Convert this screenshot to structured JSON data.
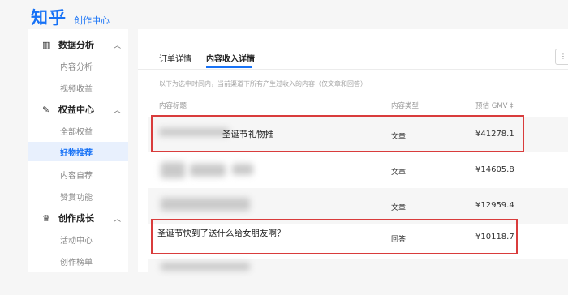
{
  "brand": {
    "logo": "知乎",
    "subtitle": "创作中心"
  },
  "sidebar": {
    "groups": [
      {
        "label": "数据分析",
        "icon": "bar-chart-icon",
        "items": [
          "内容分析",
          "视频收益"
        ]
      },
      {
        "label": "权益中心",
        "icon": "pen-icon",
        "items": [
          "全部权益",
          "好物推荐",
          "内容自荐",
          "赞赏功能"
        ]
      },
      {
        "label": "创作成长",
        "icon": "cup-icon",
        "items": [
          "活动中心",
          "创作榜单"
        ]
      }
    ],
    "active_item": "好物推荐"
  },
  "main": {
    "tabs": [
      "订单详情",
      "内容收入详情"
    ],
    "active_tab": "内容收入详情",
    "note": "以下为选中时间内，当前渠道下所有产生过收入的内容（仅文章和回答）",
    "columns": [
      "内容标题",
      "内容类型",
      "预估 GMV ‡"
    ],
    "rows": [
      {
        "title": "圣诞节礼物推",
        "type": "文章",
        "gmv": "¥41278.1"
      },
      {
        "title": "",
        "type": "文章",
        "gmv": "¥14605.8"
      },
      {
        "title": "",
        "type": "文章",
        "gmv": "¥12959.4"
      },
      {
        "title": "圣诞节快到了送什么给女朋友啊？",
        "type": "回答",
        "gmv": "¥10118.7"
      }
    ]
  },
  "colors": {
    "accent": "#1772f6",
    "highlight": "#d93c3c"
  }
}
